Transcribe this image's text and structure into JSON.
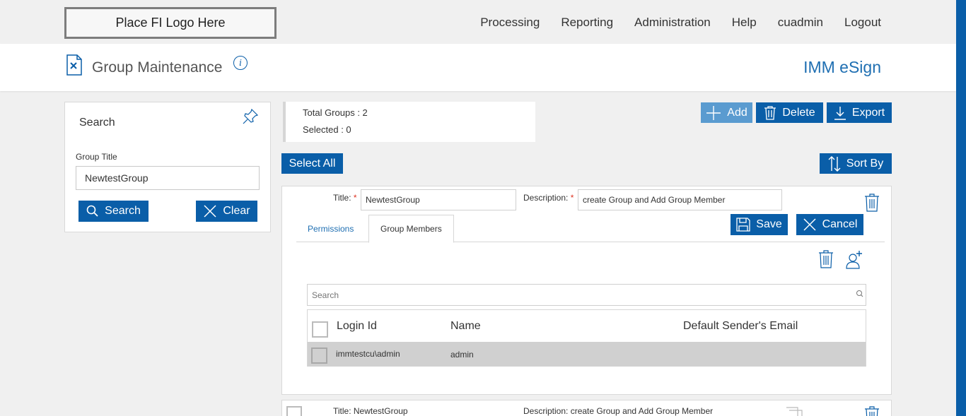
{
  "logo": {
    "text": "Place FI Logo Here"
  },
  "nav": [
    "Processing",
    "Reporting",
    "Administration",
    "Help",
    "cuadmin",
    "Logout"
  ],
  "header": {
    "title": "Group Maintenance",
    "info": "i",
    "brand": "IMM eSign"
  },
  "search_panel": {
    "title": "Search",
    "field_label": "Group Title",
    "field_value": "NewtestGroup",
    "search_label": "Search",
    "clear_label": "Clear"
  },
  "summary": {
    "total": "Total Groups : 2",
    "selected": "Selected : 0"
  },
  "toolbar": {
    "add": "Add",
    "delete": "Delete",
    "export": "Export",
    "select_all": "Select All",
    "sort_by": "Sort By"
  },
  "group_edit": {
    "title_label": "Title:",
    "title_value": "NewtestGroup",
    "description_label": "Description:",
    "description_value": "create Group and Add Group Member",
    "required_mark": "*",
    "save": "Save",
    "cancel": "Cancel",
    "tabs": [
      "Permissions",
      "Group Members"
    ],
    "member_search_placeholder": "Search",
    "columns": [
      "Login Id",
      "Name",
      "Default Sender's Email"
    ],
    "rows": [
      {
        "login_id": "immtestcu\\admin",
        "name": "admin",
        "email": ""
      }
    ]
  },
  "next_group": {
    "title": "Title:  NewtestGroup",
    "description": "Description: create Group and Add Group Member"
  },
  "colors": {
    "primary": "#0a5ea8",
    "brand_text": "#1f6fb2",
    "add_button": "#5a9bd0",
    "row_bg": "#d0d0d0"
  }
}
